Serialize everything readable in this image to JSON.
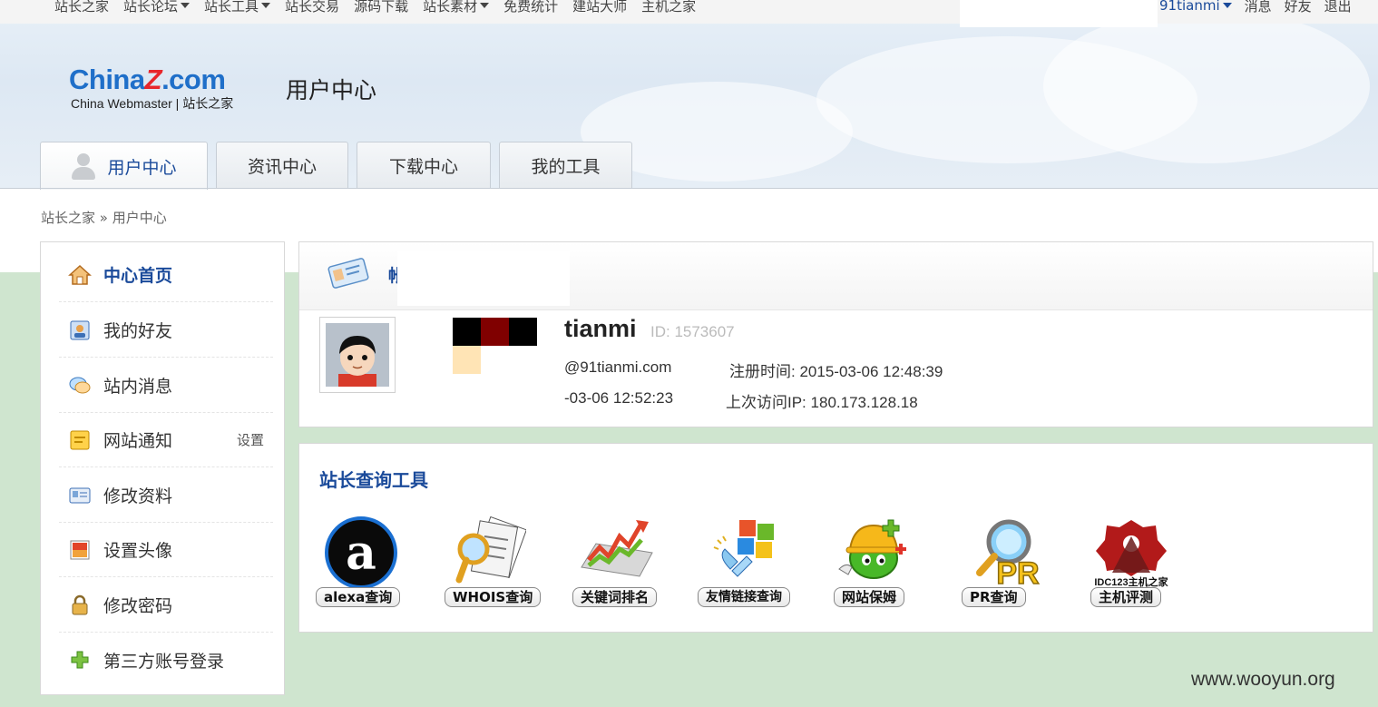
{
  "topnav": {
    "items": [
      {
        "label": "站长之家",
        "dropdown": false
      },
      {
        "label": "站长论坛",
        "dropdown": true
      },
      {
        "label": "站长工具",
        "dropdown": true
      },
      {
        "label": "站长交易",
        "dropdown": false
      },
      {
        "label": "源码下载",
        "dropdown": false
      },
      {
        "label": "站长素材",
        "dropdown": true
      },
      {
        "label": "免费统计",
        "dropdown": false
      },
      {
        "label": "建站大师",
        "dropdown": false
      },
      {
        "label": "主机之家",
        "dropdown": false
      }
    ],
    "user": "91tianmi",
    "messages": "消息",
    "friends": "好友",
    "logout": "退出"
  },
  "logo": {
    "brand_main": "China",
    "brand_z": "Z",
    "brand_tail": ".com",
    "subtitle": "China Webmaster | 站长之家"
  },
  "site_title": "用户中心",
  "tabs": [
    {
      "label": "用户中心",
      "active": true
    },
    {
      "label": "资讯中心",
      "active": false
    },
    {
      "label": "下载中心",
      "active": false
    },
    {
      "label": "我的工具",
      "active": false
    }
  ],
  "breadcrumb": {
    "home": "站长之家",
    "sep": "»",
    "current": "用户中心"
  },
  "sidebar": {
    "items": [
      {
        "label": "中心首页",
        "icon": "home-icon"
      },
      {
        "label": "我的好友",
        "icon": "contacts-icon"
      },
      {
        "label": "站内消息",
        "icon": "chat-bubble-icon"
      },
      {
        "label": "网站通知",
        "icon": "notice-icon",
        "extra": "设置"
      },
      {
        "label": "修改资料",
        "icon": "profile-card-icon"
      },
      {
        "label": "设置头像",
        "icon": "picture-icon"
      },
      {
        "label": "修改密码",
        "icon": "lock-icon"
      },
      {
        "label": "第三方账号登录",
        "icon": "plus-icon"
      }
    ]
  },
  "profile": {
    "header_fragment": "帐",
    "username_fragment": "tianmi",
    "id_label": "ID: 1573607",
    "email_fragment": "@91tianmi.com",
    "register_label": "注册时间:",
    "register_time": "2015-03-06 12:48:39",
    "last_login_fragment": "-03-06 12:52:23",
    "last_ip_label": "上次访问IP:",
    "last_ip": "180.173.128.18",
    "colors": {
      "black": "#000000",
      "maroon": "#800000",
      "cream": "#ffe4b5"
    }
  },
  "tools": {
    "title": "站长查询工具",
    "items": [
      {
        "label": "alexa查询",
        "icon": "alexa-icon"
      },
      {
        "label": "WHOIS查询",
        "icon": "whois-icon"
      },
      {
        "label": "关键词排名",
        "icon": "keyword-rank-icon"
      },
      {
        "label": "友情链接查询",
        "icon": "friend-link-icon"
      },
      {
        "label": "网站保姆",
        "icon": "site-guard-icon"
      },
      {
        "label": "PR查询",
        "icon": "pr-icon"
      },
      {
        "label": "主机评测",
        "icon": "host-review-icon"
      }
    ],
    "host_logo_text": "IDC123主机之家"
  },
  "watermark": "www.wooyun.org",
  "accent": "#1a4a9a",
  "page_bg": "#cfe5cf"
}
